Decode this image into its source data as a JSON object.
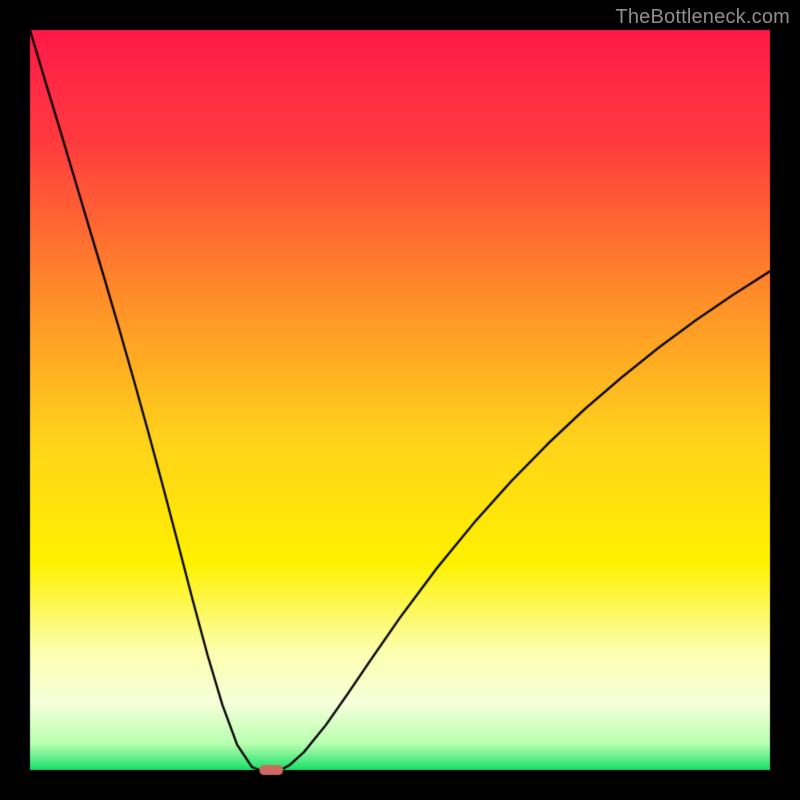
{
  "watermark": "TheBottleneck.com",
  "colors": {
    "border": "#000000",
    "curve": "#000000",
    "marker": "#cf6a62",
    "gradient_stops": [
      {
        "t": 0.0,
        "c": "#ff1a49"
      },
      {
        "t": 0.15,
        "c": "#ff3b3f"
      },
      {
        "t": 0.35,
        "c": "#ff8a2a"
      },
      {
        "t": 0.55,
        "c": "#ffd21c"
      },
      {
        "t": 0.72,
        "c": "#fff200"
      },
      {
        "t": 0.84,
        "c": "#fdffb0"
      },
      {
        "t": 0.91,
        "c": "#f6ffda"
      },
      {
        "t": 0.965,
        "c": "#b8ffb0"
      },
      {
        "t": 1.0,
        "c": "#18e06a"
      }
    ]
  },
  "layout": {
    "outer_w": 800,
    "outer_h": 800,
    "inner_x": 30,
    "inner_y": 30,
    "inner_w": 740,
    "inner_h": 740
  },
  "chart_data": {
    "type": "line",
    "title": "",
    "xlabel": "",
    "ylabel": "",
    "xlim": [
      0,
      100
    ],
    "ylim": [
      0,
      100
    ],
    "x": [
      0,
      2,
      4,
      6,
      8,
      10,
      12,
      14,
      16,
      18,
      20,
      22,
      24,
      26,
      28,
      30,
      31,
      32,
      33,
      33.8,
      35,
      37,
      40,
      43,
      46,
      50,
      55,
      60,
      65,
      70,
      75,
      80,
      85,
      90,
      95,
      100
    ],
    "values": [
      100,
      93.3,
      86.7,
      80,
      73.3,
      66.6,
      59.8,
      52.8,
      45.6,
      38.2,
      30.6,
      22.9,
      15.5,
      8.8,
      3.4,
      0.4,
      0,
      0,
      0,
      0,
      0.6,
      2.4,
      6.1,
      10.4,
      14.8,
      20.6,
      27.3,
      33.4,
      39,
      44.1,
      48.8,
      53.1,
      57.1,
      60.8,
      64.2,
      67.4
    ],
    "marker": {
      "x0": 31,
      "x1": 34.2,
      "y": 0,
      "rx": 6,
      "ry": 5
    }
  }
}
